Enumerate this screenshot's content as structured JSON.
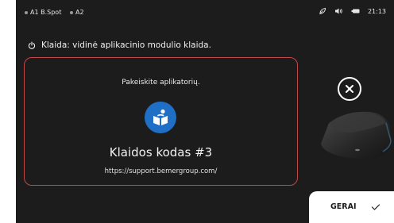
{
  "status_bar": {
    "applicator_1": "A1 B.Spot",
    "applicator_2": "A2",
    "time": "21:13",
    "icons": [
      "leaf-icon",
      "speaker-icon",
      "battery-icon"
    ]
  },
  "error": {
    "message": "Klaida: vidinė aplikacinio modulio klaida.",
    "icon": "power-icon"
  },
  "dialog": {
    "instruction": "Pakeiskite aplikatorių.",
    "icon": "manual-book-icon",
    "error_code": "Klaidos kodas #3",
    "support_url": "https://support.bemergroup.com/"
  },
  "actions": {
    "close_icon": "close-icon",
    "ok_label": "GERAI"
  },
  "colors": {
    "background": "#1c1c1c",
    "dialog_border": "#c24848",
    "icon_blue": "#1f6fc7",
    "button_bg": "#ffffff"
  }
}
